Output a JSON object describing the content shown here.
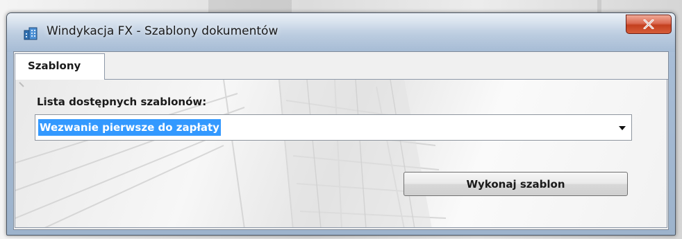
{
  "window": {
    "title": "Windykacja FX - Szablony dokumentów",
    "close_glyph": "x",
    "icon": "app-icon"
  },
  "tabs": [
    {
      "label": "Szablony",
      "active": true
    }
  ],
  "form": {
    "list_label": "Lista dostępnych szablonów:",
    "selected_template": "Wezwanie pierwsze do zapłaty",
    "execute_button": "Wykonaj szablon"
  },
  "colors": {
    "selection": "#3399ff",
    "close_button": "#c4401f",
    "titlebar": "#a8bdd6"
  }
}
